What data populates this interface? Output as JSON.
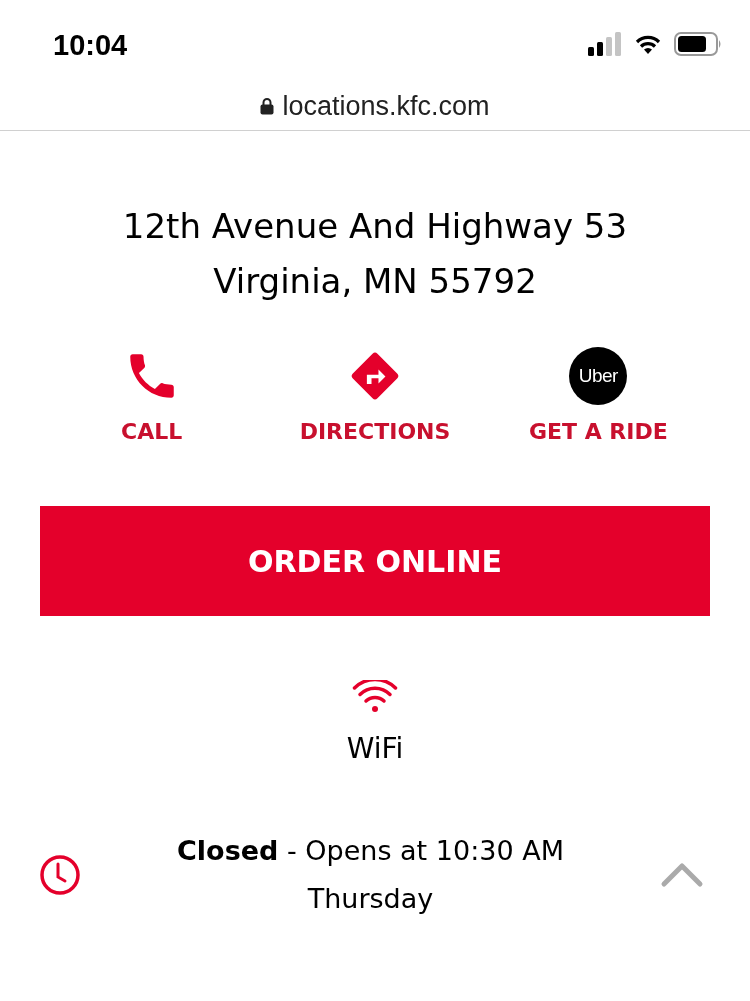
{
  "status_bar": {
    "time": "10:04"
  },
  "url_bar": {
    "url": "locations.kfc.com"
  },
  "address": [
    "12th Avenue And Highway 53",
    "Virginia, MN 55792"
  ],
  "actions": [
    {
      "kind": "phone",
      "label": "CALL"
    },
    {
      "kind": "directions",
      "label": "DIRECTIONS"
    },
    {
      "kind": "uber",
      "label": "GET A RIDE",
      "logo_text": "Uber"
    }
  ],
  "order_button": {
    "label": "ORDER ONLINE"
  },
  "amenity": {
    "label": "WiFi"
  },
  "hours": {
    "status": "**Closed** - Opens at 10:30 AM",
    "day": "Thursday",
    "expanded": true
  }
}
